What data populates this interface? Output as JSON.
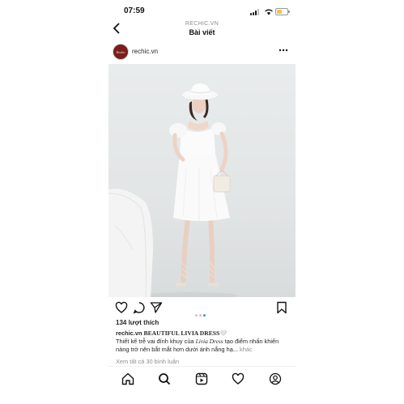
{
  "status": {
    "time": "07:59"
  },
  "nav": {
    "subtitle": "RECHIC.VN",
    "title": "Bài viết",
    "back_glyph": "‹"
  },
  "post": {
    "avatar_text": "Rechic",
    "username": "rechic.vn",
    "more_glyph": "•••",
    "carousel": {
      "count": 3,
      "active": 3
    }
  },
  "engagement": {
    "likes": "134 lượt thích"
  },
  "caption": {
    "username": "rechic.vn",
    "title": "BEAUTIFUL LIVIA DRESS",
    "heart": "🤍",
    "text_before": "Thiết kế trễ vai đính khuy của ",
    "italic": "Livia Dress",
    "text_after": " tạo điểm nhấn khiến nàng trở nên bắt mắt hơn dưới ánh nắng hạ...",
    "more": " khác"
  },
  "comments_link": "Xem tất cả 30 bình luận",
  "icons": {
    "back": "chevron-left-icon",
    "more": "more-horizontal-icon",
    "like": "heart-icon",
    "comment": "comment-icon",
    "share": "send-icon",
    "save": "bookmark-icon",
    "home": "home-icon",
    "search": "search-icon",
    "reels": "reels-icon",
    "activity": "heart-icon",
    "profile": "profile-icon"
  },
  "colors": {
    "link_blue": "#3897f0",
    "battery": "#f5c542",
    "avatar": "#7a1d1d"
  }
}
